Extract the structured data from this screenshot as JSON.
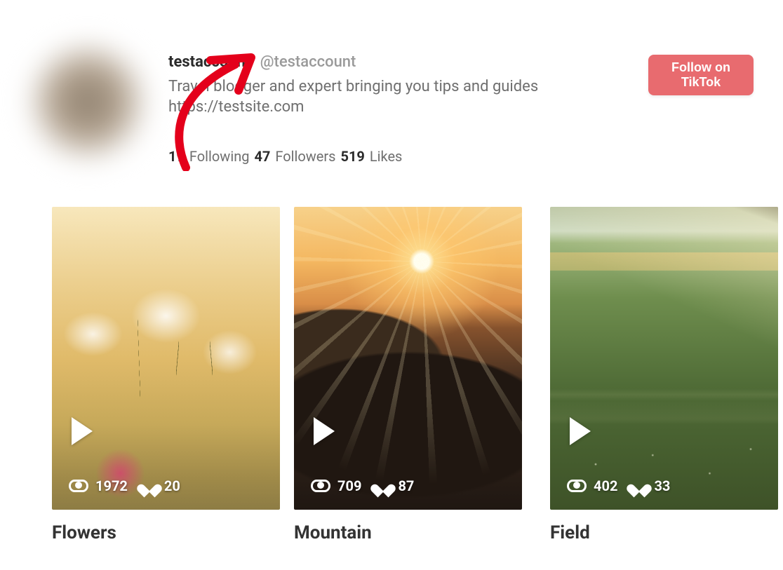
{
  "profile": {
    "display_name": "testaccount",
    "handle": "@testaccount",
    "bio_line": "Travel blogger and expert bringing you tips and guides",
    "bio_url": "https://testsite.com",
    "stats": {
      "following_count": "19",
      "following_label": "Following",
      "followers_count": "47",
      "followers_label": "Followers",
      "likes_count": "519",
      "likes_label": "Likes"
    }
  },
  "follow_button": {
    "label": "Follow on\nTikTok",
    "color": "#e86b6f"
  },
  "annotation": {
    "type": "hand-drawn-arrow",
    "color": "#e4001b",
    "points_to": "display_name"
  },
  "feed": [
    {
      "title": "Flowers",
      "thumb_class": "flowers",
      "views": "1972",
      "likes": "20"
    },
    {
      "title": "Mountain",
      "thumb_class": "mountain",
      "views": "709",
      "likes": "87"
    },
    {
      "title": "Field",
      "thumb_class": "field",
      "views": "402",
      "likes": "33"
    }
  ]
}
